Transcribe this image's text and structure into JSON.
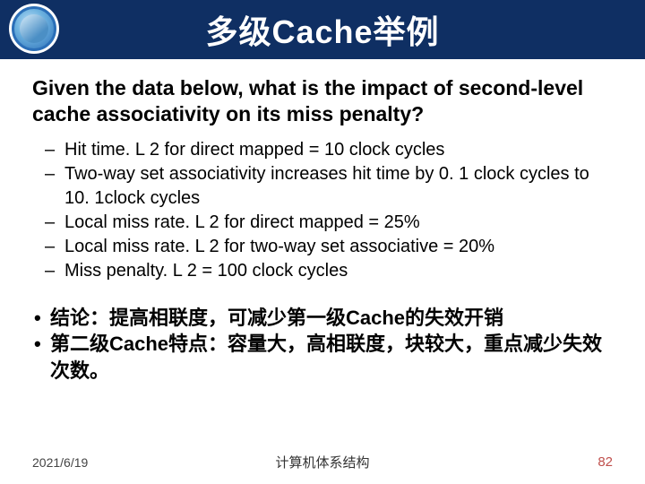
{
  "header": {
    "title": "多级Cache举例",
    "logo_name": "university-seal"
  },
  "body": {
    "question": "Given the data below, what is the impact of second-level cache associativity on its miss penalty?",
    "facts": [
      "Hit time. L 2 for direct mapped = 10 clock cycles",
      "Two-way set associativity increases hit time by 0. 1 clock cycles to 10. 1clock cycles",
      "Local miss rate. L 2 for direct mapped = 25%",
      "Local miss rate. L 2 for two-way set associative = 20%",
      "Miss penalty. L 2 = 100 clock cycles"
    ],
    "conclusions": [
      "结论：提高相联度，可减少第一级Cache的失效开销",
      "第二级Cache特点：容量大，高相联度，块较大，重点减少失效次数。"
    ]
  },
  "footer": {
    "date": "2021/6/19",
    "course": "计算机体系结构",
    "page": "82"
  }
}
